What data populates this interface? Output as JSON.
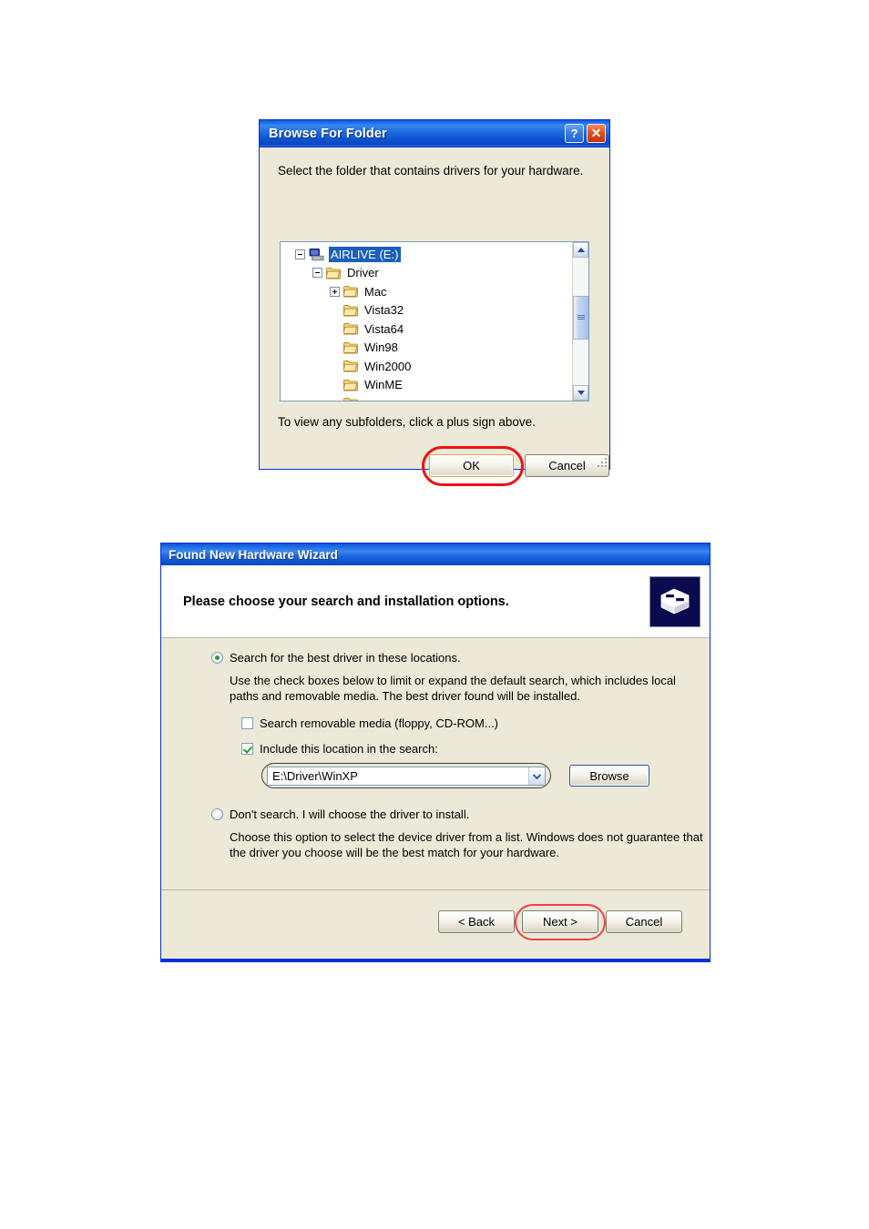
{
  "browse_dialog": {
    "title": "Browse For Folder",
    "help_button": "?",
    "close_button": "✕",
    "prompt": "Select the folder that contains drivers for your hardware.",
    "tree": [
      {
        "label": "AIRLIVE (E:)",
        "icon": "drive-icon",
        "depth": 0,
        "expander": "minus",
        "selected": true
      },
      {
        "label": "Driver",
        "icon": "folder-icon",
        "depth": 1,
        "expander": "minus",
        "selected": false
      },
      {
        "label": "Mac",
        "icon": "folder-icon",
        "depth": 2,
        "expander": "plus",
        "selected": false
      },
      {
        "label": "Vista32",
        "icon": "folder-icon",
        "depth": 2,
        "expander": "none",
        "selected": false
      },
      {
        "label": "Vista64",
        "icon": "folder-icon",
        "depth": 2,
        "expander": "none",
        "selected": false
      },
      {
        "label": "Win98",
        "icon": "folder-icon",
        "depth": 2,
        "expander": "none",
        "selected": false
      },
      {
        "label": "Win2000",
        "icon": "folder-icon",
        "depth": 2,
        "expander": "none",
        "selected": false
      },
      {
        "label": "WinME",
        "icon": "folder-icon",
        "depth": 2,
        "expander": "none",
        "selected": false
      }
    ],
    "hint": "To view any subfolders, click a plus sign above.",
    "ok_label": "OK",
    "cancel_label": "Cancel",
    "highlight_color": "#ee1111",
    "focus_border_color": "#e8a33d",
    "titlebar_color": "#0a56d6",
    "selection_color": "#1a5fbe"
  },
  "wizard": {
    "title": "Found New Hardware Wizard",
    "heading": "Please choose your search and installation options.",
    "header_icon": "hardware-device-icon",
    "option_search": {
      "label": "Search for the best driver in these locations.",
      "selected": true,
      "description": "Use the check boxes below to limit or expand the default search, which includes local paths and removable media. The best driver found will be installed."
    },
    "checkbox_removable": {
      "label": "Search removable media (floppy, CD-ROM...)",
      "checked": false
    },
    "checkbox_include": {
      "label": "Include this location in the search:",
      "checked": true
    },
    "location_combo": {
      "value": "E:\\Driver\\WinXP",
      "arrow_icon": "chevron-down-icon"
    },
    "browse_label": "Browse",
    "option_no_search": {
      "label": "Don't search. I will choose the driver to install.",
      "selected": false,
      "description": "Choose this option to select the device driver from a list.  Windows does not guarantee that the driver you choose will be the best match for your hardware."
    },
    "back_label": "< Back",
    "next_label": "Next >",
    "cancel_label": "Cancel",
    "highlight_color": "#f44040",
    "titlebar_color": "#0a56d6",
    "body_color": "#ece9d8"
  }
}
